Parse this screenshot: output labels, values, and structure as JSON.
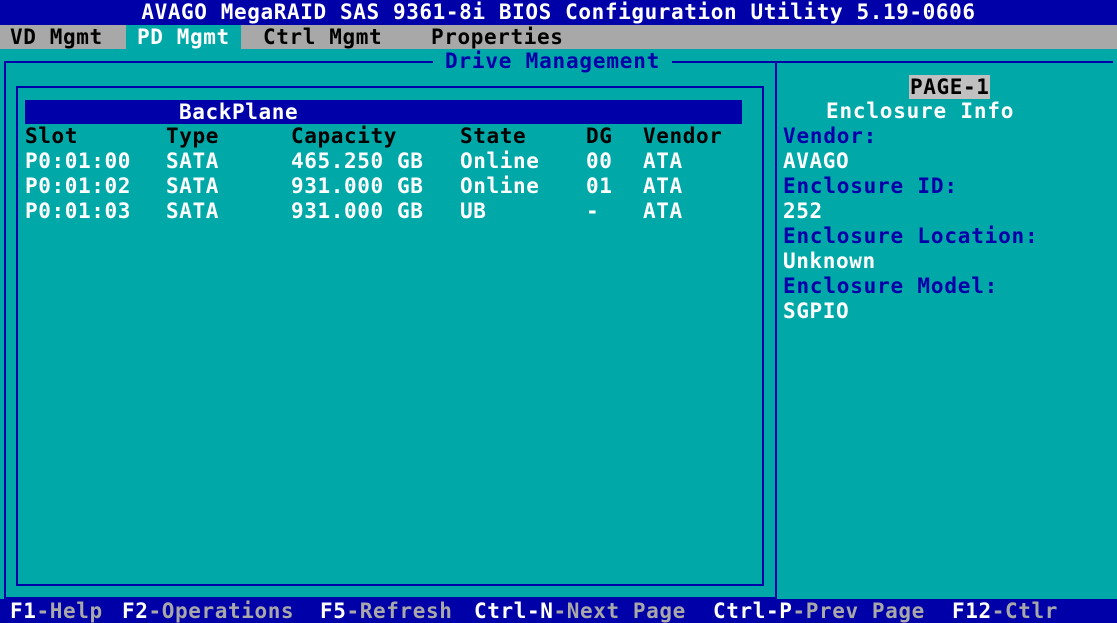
{
  "title": "AVAGO MegaRAID SAS 9361-8i BIOS Configuration Utility 5.19-0606",
  "menu": {
    "vd_mgmt": "VD Mgmt",
    "pd_mgmt": "PD Mgmt",
    "ctrl_mgmt": "Ctrl Mgmt",
    "properties": "Properties"
  },
  "panel_title": "Drive Management",
  "backplane": {
    "header": "BackPlane",
    "columns": {
      "slot": "Slot",
      "type": "Type",
      "capacity": "Capacity",
      "state": "State",
      "dg": "DG",
      "vendor": "Vendor"
    },
    "rows": [
      {
        "slot": "P0:01:00",
        "type": "SATA",
        "capacity": "465.250 GB",
        "state": "Online",
        "dg": "00",
        "vendor": "ATA"
      },
      {
        "slot": "P0:01:02",
        "type": "SATA",
        "capacity": "931.000 GB",
        "state": "Online",
        "dg": "01",
        "vendor": "ATA"
      },
      {
        "slot": "P0:01:03",
        "type": "SATA",
        "capacity": "931.000 GB",
        "state": "UB",
        "dg": "-",
        "vendor": "ATA"
      }
    ]
  },
  "info_panel": {
    "page": "PAGE-1",
    "title": "Enclosure Info",
    "vendor_label": "Vendor:",
    "vendor_value": "AVAGO",
    "enclosure_id_label": "Enclosure ID:",
    "enclosure_id_value": "252",
    "enclosure_location_label": "Enclosure Location:",
    "enclosure_location_value": "Unknown",
    "enclosure_model_label": "Enclosure Model:",
    "enclosure_model_value": "SGPIO"
  },
  "footer": {
    "f1_key": "F1",
    "f1_desc": "-Help",
    "f2_key": "F2",
    "f2_desc": "-Operations",
    "f5_key": "F5",
    "f5_desc": "-Refresh",
    "ctrln_key": "Ctrl-N",
    "ctrln_desc": "-Next Page",
    "ctrlp_key": "Ctrl-P",
    "ctrlp_desc": "-Prev Page",
    "f12_key": "F12",
    "f12_desc": "-Ctlr"
  },
  "colors": {
    "background": "#00a8a8",
    "title_bar": "#0000a8",
    "menu_bar": "#a8a8a8",
    "label_blue": "#0000a8"
  }
}
